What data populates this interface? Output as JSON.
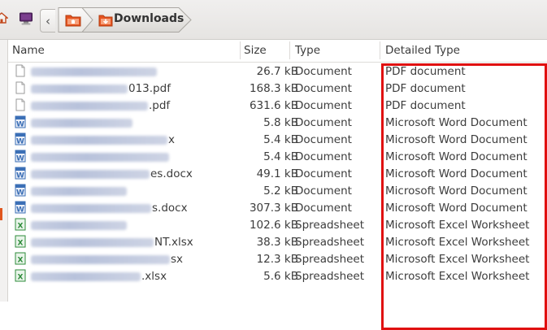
{
  "toolbar": {
    "back_label": "‹",
    "breadcrumb_current": "Downloads"
  },
  "columns": {
    "name": "Name",
    "size": "Size",
    "type": "Type",
    "detailed_type": "Detailed Type"
  },
  "files": [
    {
      "name_suffix": "",
      "size": "26.7 kB",
      "type": "Document",
      "detailed_type": "PDF document",
      "icon": "pdf-icon"
    },
    {
      "name_suffix": "013.pdf",
      "size": "168.3 kB",
      "type": "Document",
      "detailed_type": "PDF document",
      "icon": "pdf-icon"
    },
    {
      "name_suffix": ".pdf",
      "size": "631.6 kB",
      "type": "Document",
      "detailed_type": "PDF document",
      "icon": "pdf-icon"
    },
    {
      "name_suffix": "",
      "size": "5.8 kB",
      "type": "Document",
      "detailed_type": "Microsoft Word Document",
      "icon": "word-icon"
    },
    {
      "name_suffix": "x",
      "size": "5.4 kB",
      "type": "Document",
      "detailed_type": "Microsoft Word Document",
      "icon": "word-icon"
    },
    {
      "name_suffix": "",
      "size": "5.4 kB",
      "type": "Document",
      "detailed_type": "Microsoft Word Document",
      "icon": "word-icon"
    },
    {
      "name_suffix": "es.docx",
      "size": "49.1 kB",
      "type": "Document",
      "detailed_type": "Microsoft Word Document",
      "icon": "word-icon"
    },
    {
      "name_suffix": "",
      "size": "5.2 kB",
      "type": "Document",
      "detailed_type": "Microsoft Word Document",
      "icon": "word-icon"
    },
    {
      "name_suffix": "s.docx",
      "size": "307.3 kB",
      "type": "Document",
      "detailed_type": "Microsoft Word Document",
      "icon": "word-icon"
    },
    {
      "name_suffix": "",
      "size": "102.6 kB",
      "type": "Spreadsheet",
      "detailed_type": "Microsoft Excel Worksheet",
      "icon": "excel-icon"
    },
    {
      "name_suffix": "NT.xlsx",
      "size": "38.3 kB",
      "type": "Spreadsheet",
      "detailed_type": "Microsoft Excel Worksheet",
      "icon": "excel-icon"
    },
    {
      "name_suffix": "sx",
      "size": "12.3 kB",
      "type": "Spreadsheet",
      "detailed_type": "Microsoft Excel Worksheet",
      "icon": "excel-icon"
    },
    {
      "name_suffix": ".xlsx",
      "size": "5.6 kB",
      "type": "Spreadsheet",
      "detailed_type": "Microsoft Excel Worksheet",
      "icon": "excel-icon"
    }
  ],
  "colors": {
    "highlight": "#e01010",
    "word": "#3b6fb6",
    "excel": "#2e8b3a"
  }
}
